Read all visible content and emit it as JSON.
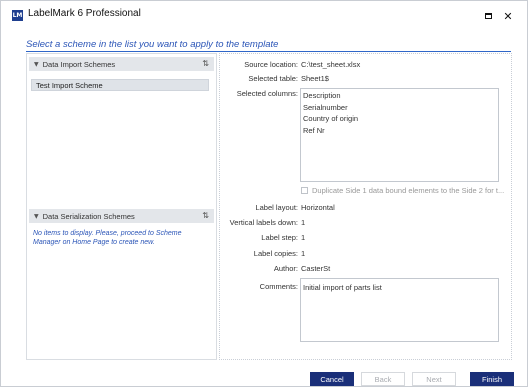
{
  "window": {
    "app_title": "LabelMark 6 Professional",
    "logo_text": "LM",
    "controls": {
      "maximize_icon": "maximize-icon",
      "close_glyph": "✕"
    }
  },
  "instruction": "Select a scheme in the list you want to apply to the template",
  "left_panel": {
    "import_section": {
      "title": "Data Import Schemes",
      "sort_glyph": "⇅",
      "items": [
        {
          "label": "Test Import Scheme"
        }
      ]
    },
    "serialization_section": {
      "title": "Data Serialization Schemes",
      "sort_glyph": "⇅",
      "empty_message": "No items to display. Please, proceed to Scheme Manager on Home Page to create new."
    }
  },
  "details": {
    "source_location": {
      "label": "Source location:",
      "value": "C:\\test_sheet.xlsx"
    },
    "selected_table": {
      "label": "Selected table:",
      "value": "Sheet1$"
    },
    "selected_columns": {
      "label": "Selected columns:",
      "values": [
        "Description",
        "Serialnumber",
        "Country of origin",
        "Ref Nr"
      ]
    },
    "duplicate_checkbox": {
      "label": "Duplicate Side 1 data bound elements to the Side 2 for t...",
      "checked": false
    },
    "label_layout": {
      "label": "Label layout:",
      "value": "Horizontal"
    },
    "vertical_labels_down": {
      "label": "Vertical labels down:",
      "value": "1"
    },
    "label_step": {
      "label": "Label step:",
      "value": "1"
    },
    "label_copies": {
      "label": "Label copies:",
      "value": "1"
    },
    "author": {
      "label": "Author:",
      "value": "CasterSt"
    },
    "comments": {
      "label": "Comments:",
      "value": "Initial import of parts list"
    }
  },
  "footer": {
    "cancel": "Cancel",
    "back": "Back",
    "next": "Next",
    "finish": "Finish"
  },
  "colors": {
    "accent_blue": "#2b55b7",
    "primary_button": "#1a2f79",
    "section_header_bg": "#e3e6ea"
  }
}
